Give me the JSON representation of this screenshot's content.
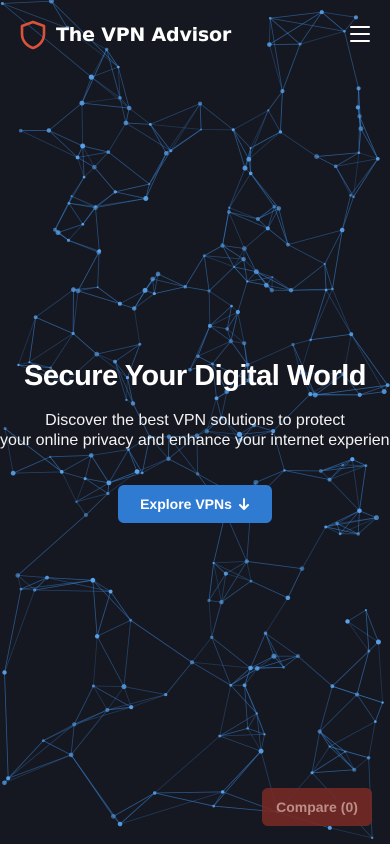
{
  "header": {
    "brand": "The VPN Advisor",
    "shield_icon": "shield-icon",
    "menu_icon": "hamburger-menu-icon"
  },
  "hero": {
    "title": "Secure Your Digital World",
    "subtitle_line1": "Discover the best VPN solutions to protect",
    "subtitle_line2": "your online privacy and enhance your internet experience.",
    "cta_label": "Explore VPNs",
    "cta_icon": "arrow-down-icon"
  },
  "compare": {
    "label": "Compare",
    "count": "(0)"
  },
  "colors": {
    "background": "#161821",
    "network": "#3a8ee6",
    "accent": "#2e7bd1",
    "shield": "#d9533b",
    "compare_bg": "#7a2a24"
  }
}
